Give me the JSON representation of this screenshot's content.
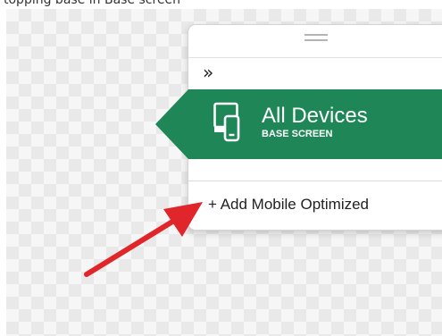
{
  "caption": "topping base in Base screen",
  "panel": {
    "expand_icon": "»",
    "device": {
      "title": "All Devices",
      "subtitle": "BASE SCREEN",
      "icon": "devices-icon",
      "color": "#1f8757"
    },
    "add_button_label": "+ Add Mobile Optimized"
  },
  "annotation": {
    "type": "red-arrow",
    "color": "#e0262a"
  }
}
